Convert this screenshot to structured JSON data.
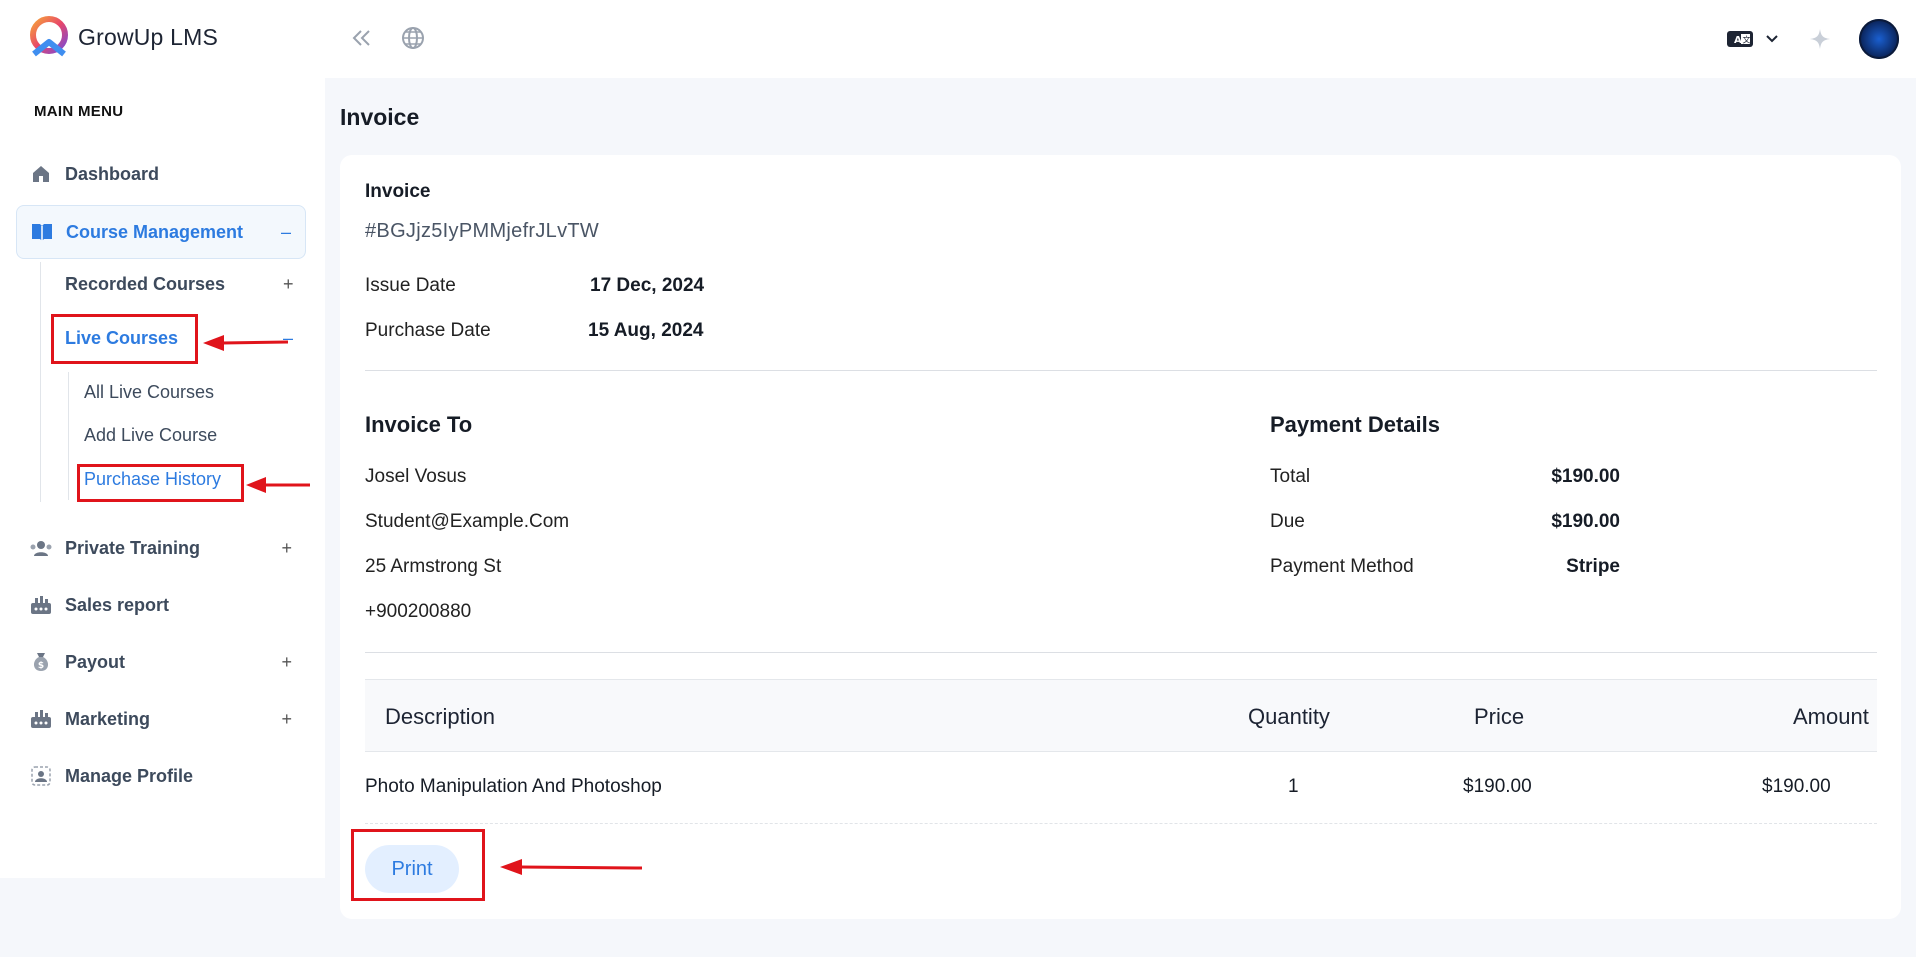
{
  "app": {
    "name": "GrowUp LMS"
  },
  "sidebar": {
    "heading": "MAIN MENU",
    "items": [
      {
        "label": "Dashboard",
        "icon": "home-icon"
      },
      {
        "label": "Course Management",
        "icon": "book-icon",
        "toggle": "–"
      },
      {
        "label": "Private Training",
        "icon": "users-icon",
        "toggle": "+"
      },
      {
        "label": "Sales report",
        "icon": "chart-icon"
      },
      {
        "label": "Payout",
        "icon": "money-bag-icon",
        "toggle": "+"
      },
      {
        "label": "Marketing",
        "icon": "megaphone-icon",
        "toggle": "+"
      },
      {
        "label": "Manage Profile",
        "icon": "profile-icon"
      }
    ],
    "course_management": {
      "recorded": {
        "label": "Recorded Courses",
        "toggle": "+"
      },
      "live": {
        "label": "Live Courses",
        "toggle": "–"
      },
      "live_children": [
        "All Live Courses",
        "Add Live Course",
        "Purchase History"
      ]
    }
  },
  "topbar": {
    "collapse_icon": "double-chevron-left-icon",
    "globe_icon": "globe-icon",
    "language_icon": "translate-icon",
    "sparkle_icon": "sparkle-icon"
  },
  "page": {
    "title": "Invoice"
  },
  "invoice": {
    "label": "Invoice",
    "id": "#BGJjz5IyPMMjefrJLvTW",
    "issue_date_label": "Issue Date",
    "issue_date": "17 Dec, 2024",
    "purchase_date_label": "Purchase Date",
    "purchase_date": "15 Aug, 2024",
    "to": {
      "title": "Invoice To",
      "name": "Josel Vosus",
      "email": "Student@Example.Com",
      "address": "25 Armstrong St",
      "phone": "+900200880"
    },
    "payment": {
      "title": "Payment Details",
      "total_label": "Total",
      "total": "$190.00",
      "due_label": "Due",
      "due": "$190.00",
      "method_label": "Payment Method",
      "method": "Stripe"
    },
    "table": {
      "headers": [
        "Description",
        "Quantity",
        "Price",
        "Amount"
      ],
      "rows": [
        {
          "description": "Photo Manipulation And Photoshop",
          "quantity": "1",
          "price": "$190.00",
          "amount": "$190.00"
        }
      ]
    },
    "print_label": "Print"
  },
  "colors": {
    "accent": "#2d7be0",
    "annotation": "#e0141b"
  }
}
